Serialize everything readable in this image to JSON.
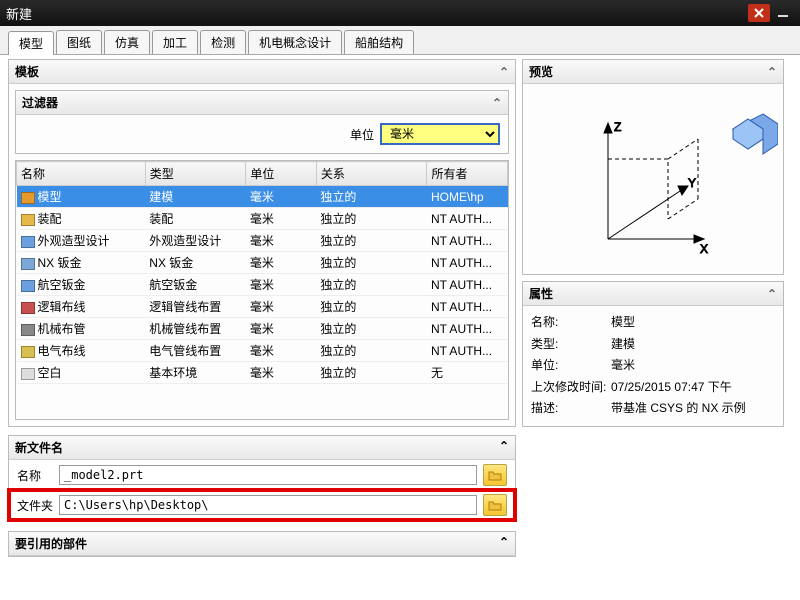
{
  "titlebar": {
    "title": "新建"
  },
  "tabs": [
    "模型",
    "图纸",
    "仿真",
    "加工",
    "检测",
    "机电概念设计",
    "船舶结构"
  ],
  "active_tab": 0,
  "template_panel": {
    "title": "模板",
    "filter_title": "过滤器",
    "filter_unit_label": "单位",
    "filter_unit_value": "毫米"
  },
  "table": {
    "headers": [
      "名称",
      "类型",
      "单位",
      "关系",
      "所有者"
    ],
    "rows": [
      {
        "name": "模型",
        "type": "建模",
        "unit": "毫米",
        "rel": "独立的",
        "owner": "HOME\\hp",
        "selected": true,
        "icon": "#e69a2e"
      },
      {
        "name": "装配",
        "type": "装配",
        "unit": "毫米",
        "rel": "独立的",
        "owner": "NT AUTH...",
        "icon": "#e6b84a"
      },
      {
        "name": "外观造型设计",
        "type": "外观造型设计",
        "unit": "毫米",
        "rel": "独立的",
        "owner": "NT AUTH...",
        "icon": "#6aa0e0"
      },
      {
        "name": "NX 钣金",
        "type": "NX 钣金",
        "unit": "毫米",
        "rel": "独立的",
        "owner": "NT AUTH...",
        "icon": "#7aa8d8"
      },
      {
        "name": "航空钣金",
        "type": "航空钣金",
        "unit": "毫米",
        "rel": "独立的",
        "owner": "NT AUTH...",
        "icon": "#6aa0e0"
      },
      {
        "name": "逻辑布线",
        "type": "逻辑管线布置",
        "unit": "毫米",
        "rel": "独立的",
        "owner": "NT AUTH...",
        "icon": "#c65050"
      },
      {
        "name": "机械布管",
        "type": "机械管线布置",
        "unit": "毫米",
        "rel": "独立的",
        "owner": "NT AUTH...",
        "icon": "#888"
      },
      {
        "name": "电气布线",
        "type": "电气管线布置",
        "unit": "毫米",
        "rel": "独立的",
        "owner": "NT AUTH...",
        "icon": "#d8c050"
      },
      {
        "name": "空白",
        "type": "基本环境",
        "unit": "毫米",
        "rel": "独立的",
        "owner": "无",
        "icon": "#ddd"
      }
    ]
  },
  "newfile": {
    "title": "新文件名",
    "name_label": "名称",
    "name_value": "_model2.prt",
    "folder_label": "文件夹",
    "folder_value": "C:\\Users\\hp\\Desktop\\"
  },
  "ref_panel": {
    "title": "要引用的部件"
  },
  "preview": {
    "title": "预览"
  },
  "properties": {
    "title": "属性",
    "rows": [
      {
        "k": "名称:",
        "v": "模型"
      },
      {
        "k": "类型:",
        "v": "建模"
      },
      {
        "k": "单位:",
        "v": "毫米"
      },
      {
        "k": "上次修改时间:",
        "v": "07/25/2015 07:47 下午"
      },
      {
        "k": "描述:",
        "v": "带基准 CSYS 的 NX 示例"
      }
    ]
  }
}
